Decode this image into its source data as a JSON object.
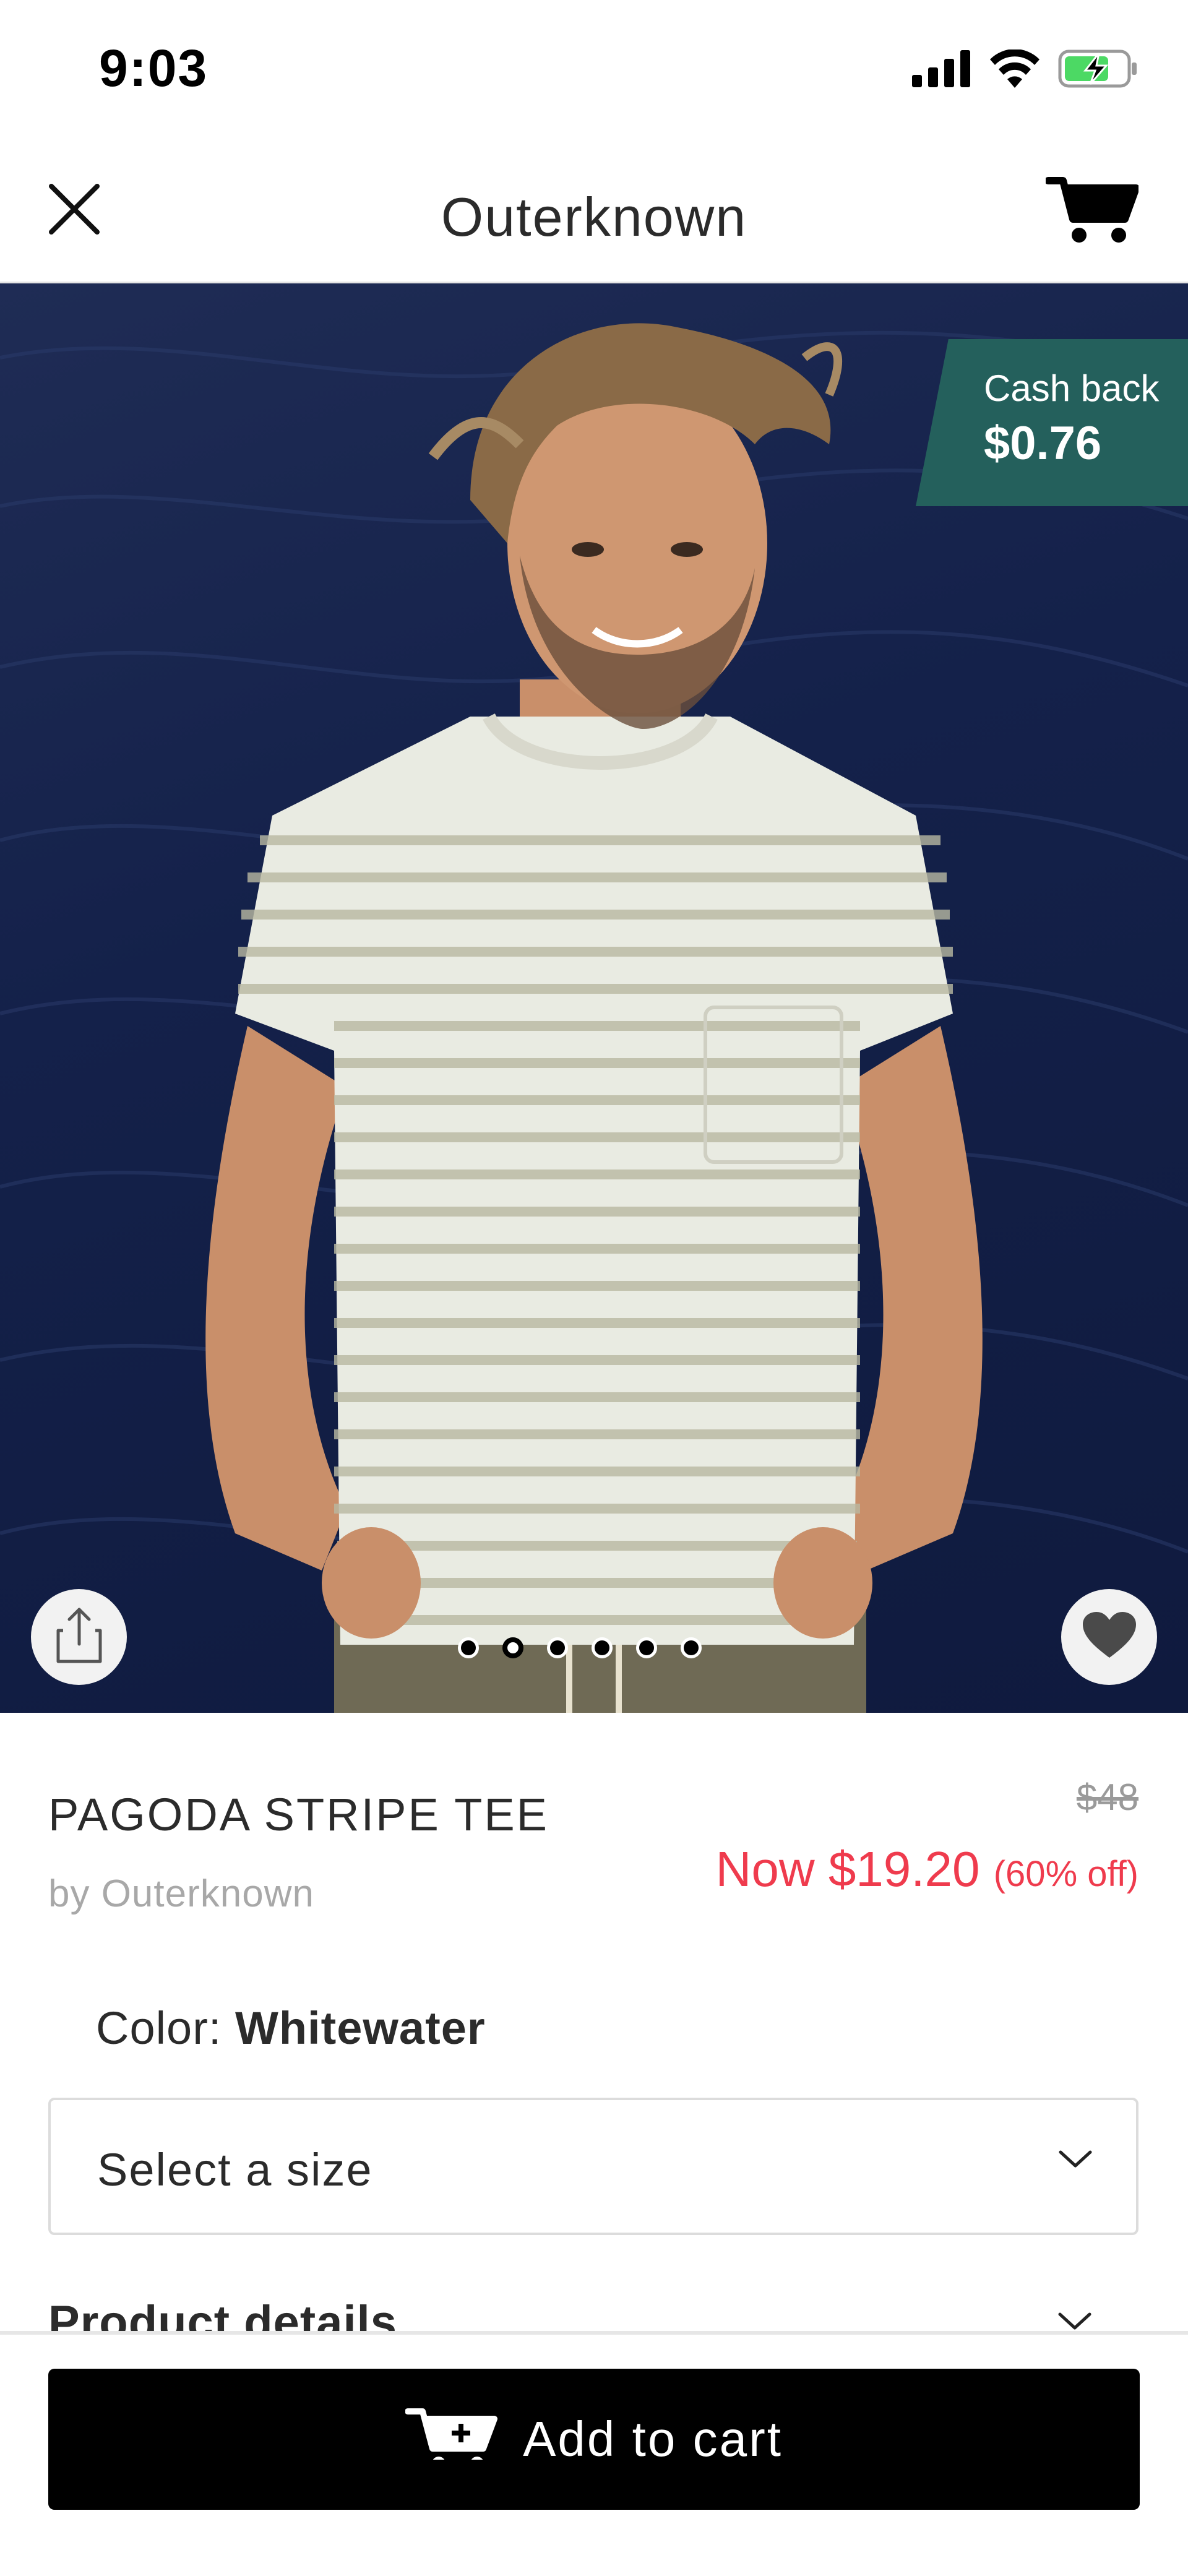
{
  "status_bar": {
    "time": "9:03",
    "icons": [
      "signal-icon",
      "wifi-icon",
      "battery-charging-icon"
    ]
  },
  "nav": {
    "title": "Outerknown",
    "close_icon": "close-icon",
    "cart_icon": "cart-icon"
  },
  "hero": {
    "cashback_label": "Cash back",
    "cashback_value": "$0.76",
    "badge_color": "#24605c",
    "image_count": 6,
    "active_image_index": 1,
    "share_icon": "share-icon",
    "favorite_icon": "heart-icon"
  },
  "product": {
    "name": "PAGODA STRIPE TEE",
    "brand": "by Outerknown",
    "original_price": "$48",
    "sale_price": "Now $19.20",
    "discount": "(60% off)",
    "sale_color": "#ef3b4d"
  },
  "options": {
    "color_label": "Color:",
    "color_value": "Whitewater",
    "size_placeholder": "Select a size"
  },
  "details": {
    "label": "Product details"
  },
  "footer": {
    "add_to_cart_label": "Add to cart",
    "button_color": "#000000"
  }
}
